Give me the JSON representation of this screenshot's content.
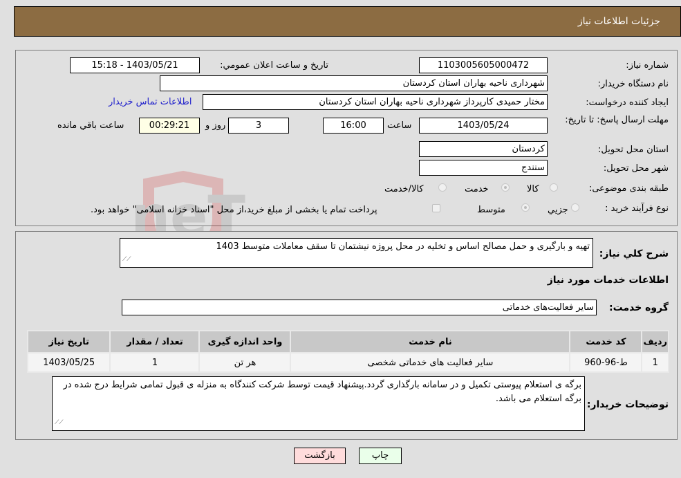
{
  "header": {
    "title": "جزئیات اطلاعات نیاز"
  },
  "details": {
    "need_number_label": "شماره نیاز:",
    "need_number": "1103005605000472",
    "announce_label": "تاریخ و ساعت اعلان عمومي:",
    "announce_value": "1403/05/21 - 15:18",
    "buyer_org_label": "نام دستگاه خريدار:",
    "buyer_org": "شهرداری ناحیه بهاران استان کردستان",
    "creator_label": "ایجاد کننده درخواست:",
    "creator": "مختار حمیدی کارپرداز شهرداری ناحیه بهاران استان کردستان",
    "contact_link": "اطلاعات تماس خریدار",
    "deadline_label": "مهلت ارسال پاسخ: تا تاریخ:",
    "deadline_date": "1403/05/24",
    "time_label": "ساعت",
    "deadline_time": "16:00",
    "days_value": "3",
    "days_label": "روز و",
    "remaining_value": "00:29:21",
    "remaining_label": "ساعت باقي مانده",
    "province_label": "استان محل تحویل:",
    "province": "کردستان",
    "city_label": "شهر محل تحویل:",
    "city": "سنندج",
    "category_label": "طبقه بندی موضوعی:",
    "category_options": [
      "کالا",
      "خدمت",
      "کالا/خدمت"
    ],
    "category_selected": "خدمت",
    "process_label": "نوع فرآیند خرید :",
    "process_options": [
      "جزيي",
      "متوسط"
    ],
    "process_selected": "متوسط",
    "treasury_note": "پرداخت تمام یا بخشی از مبلغ خرید،از محل \"اسناد خزانه اسلامی\" خواهد بود."
  },
  "summary": {
    "description_label": "شرح کلي نياز:",
    "description": "تهیه و بارگیری و حمل مصالح اساس و تخلیه در محل پروژه نیشتمان تا سقف معاملات متوسط 1403",
    "services_heading": "اطلاعات خدمات مورد نياز",
    "service_group_label": "گروه خدمت:",
    "service_group": "سایر فعالیت‌های خدماتی",
    "table": {
      "headers": [
        "رديف",
        "کد خدمت",
        "نام خدمت",
        "واحد اندازه گیری",
        "تعداد / مقدار",
        "تاریخ نیاز"
      ],
      "rows": [
        [
          "1",
          "ط-96-960",
          "سایر فعالیت های خدماتی شخصی",
          "هر تن",
          "1",
          "1403/05/25"
        ]
      ]
    },
    "buyer_notes_label": "توضیحات خریدار:",
    "buyer_notes": "برگه ی استعلام پیوستی تکمیل و در سامانه بارگذاری گردد.پیشنهاد قیمت توسط شرکت کنندگاه به منزله ی قبول تمامی شرایط درج شده در برگه استعلام می باشد."
  },
  "buttons": {
    "print": "چاپ",
    "back": "بازگشت"
  },
  "colors": {
    "header_bg": "#8c6c42",
    "print_bg": "#eaffea",
    "back_bg": "#ffdcdc",
    "link": "#2222cc"
  }
}
